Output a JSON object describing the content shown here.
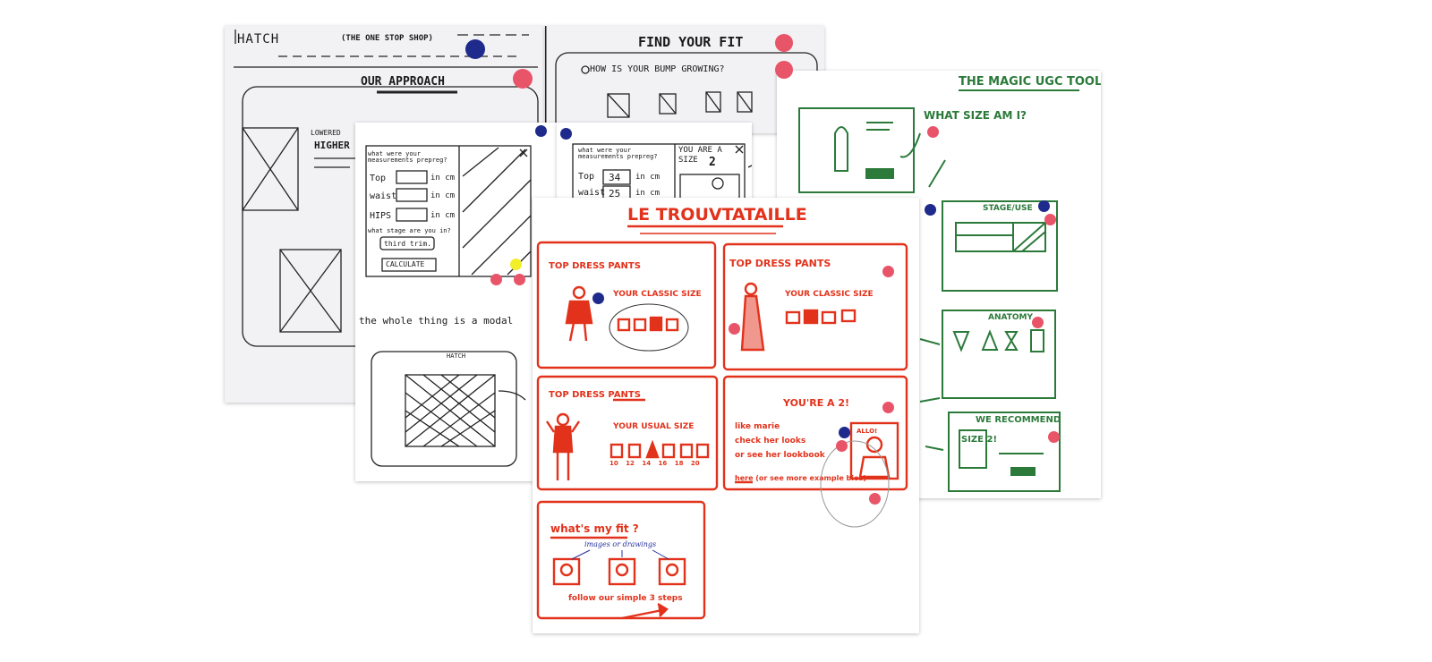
{
  "colors": {
    "red_marker": "#e2321b",
    "green_marker": "#2b7a3a",
    "pencil": "#1a1a1a",
    "dot_red": "#e85468",
    "dot_blue": "#1e2a8c",
    "dot_yellow": "#f2ee2a",
    "paper": "#f4f4f6"
  },
  "sheet1": {
    "logo": "HATCH",
    "tagline": "(THE ONE STOP SHOP)",
    "heading": "OUR APPROACH",
    "note1": "LOWERED",
    "note2": "HIGHER"
  },
  "sheet2": {
    "heading": "FIND YOUR FIT",
    "question": "HOW IS YOUR BUMP GROWING?"
  },
  "sheet3": {
    "question": "what were your measurements prepreg?",
    "top": "Top",
    "waist": "waist",
    "hips": "HIPS",
    "unit": "in cm",
    "stage": "what stage are you in?",
    "select": "third trim.",
    "button": "CALCULATE",
    "note": "the whole thing is a modal",
    "mini_logo": "HATCH"
  },
  "sheet4": {
    "question": "what were your measurements prepreg?",
    "result": "YOU ARE A SIZE",
    "size": "2",
    "top": "Top",
    "top_val": "34",
    "waist": "waist",
    "waist_val": "25",
    "unit": "in cm"
  },
  "sheet5": {
    "title": "THE MAGIC UGC TOOL!",
    "callout": "WHAT SIZE AM I?",
    "stage": "STAGE/USE",
    "anatomy": "ANATOMY",
    "recommend": "WE RECOMMEND",
    "size_box": "SIZE 2!"
  },
  "sheet6": {
    "title": "LE TROUVTATAILLE",
    "p1": {
      "title": "TOP DRESS PANTS",
      "text": "YOUR CLASSIC SIZE"
    },
    "p2": {
      "title": "TOP DRESS PANTS",
      "text": "YOUR CLASSIC SIZE"
    },
    "p3": {
      "title": "TOP DRESS PANTS",
      "text": "YOUR USUAL SIZE",
      "sizes": "10 12 14 16 18 20"
    },
    "p4": {
      "title": "YOU'RE A 2!",
      "l1": "like marie",
      "l2": "check her looks",
      "l3": "or see her lookbook",
      "l4": "here (or see more example bios)",
      "bubble": "ALLO!"
    },
    "p5": {
      "title": "what's my fit ?",
      "note": "images or drawings",
      "footer": "follow our simple 3 steps"
    }
  }
}
